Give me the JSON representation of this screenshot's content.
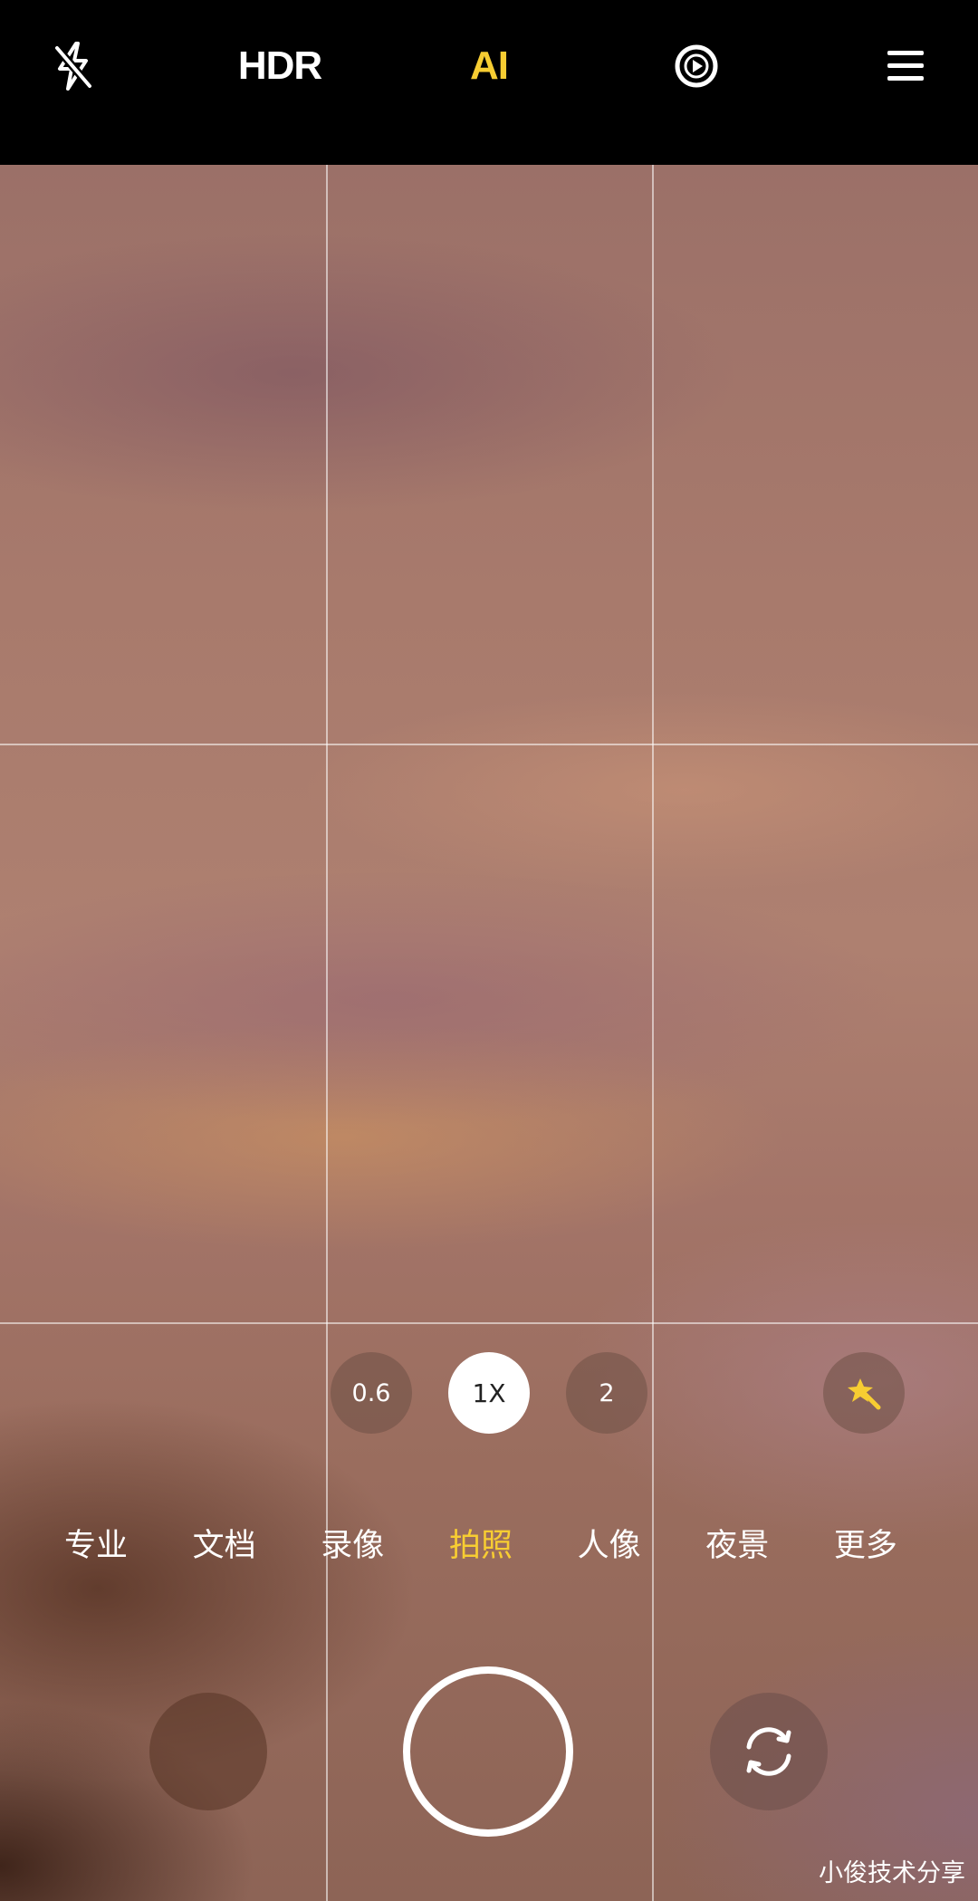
{
  "top_bar": {
    "flash": {
      "icon": "flash-off-icon"
    },
    "hdr_label": "HDR",
    "ai_label": "AI",
    "live": {
      "icon": "live-photo-icon"
    },
    "menu": {
      "icon": "menu-icon"
    },
    "colors": {
      "ai": "#f7cd32",
      "default": "#ffffff"
    }
  },
  "zoom": {
    "options": [
      "0.6",
      "1X",
      "2"
    ],
    "selected": "1X"
  },
  "beauty": {
    "icon": "magic-wand-icon",
    "color": "#f7cd32"
  },
  "modes": {
    "items": [
      "专业",
      "文档",
      "录像",
      "拍照",
      "人像",
      "夜景",
      "更多"
    ],
    "selected": "拍照",
    "accent": "#f7cd32"
  },
  "controls": {
    "gallery": {
      "icon": "gallery-thumbnail"
    },
    "shutter": {
      "icon": "shutter-icon"
    },
    "switch_camera": {
      "icon": "switch-camera-icon"
    }
  },
  "watermark": "小俊技术分享"
}
